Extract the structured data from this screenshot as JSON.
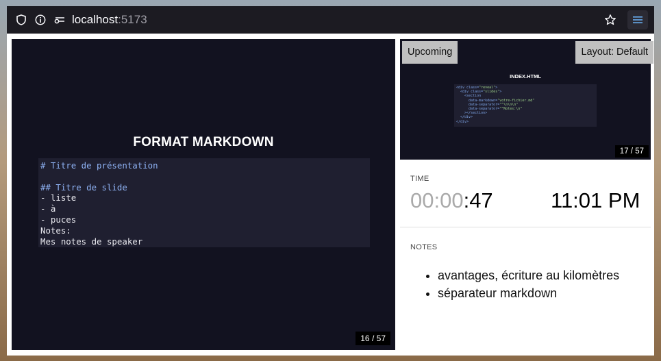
{
  "browser": {
    "url_host": "localhost",
    "url_port": ":5173"
  },
  "current_slide": {
    "title": "FORMAT MARKDOWN",
    "code_lines": [
      {
        "text": "# Titre de présentation",
        "highlight": true
      },
      {
        "text": "",
        "highlight": false
      },
      {
        "text": "## Titre de slide",
        "highlight": true
      },
      {
        "text": "- liste",
        "highlight": false
      },
      {
        "text": "- à",
        "highlight": false
      },
      {
        "text": "- puces",
        "highlight": false
      },
      {
        "text": "Notes:",
        "highlight": false
      },
      {
        "text": "Mes notes de speaker",
        "highlight": false
      }
    ],
    "counter": {
      "current": "16",
      "separator": "/",
      "total": "57"
    }
  },
  "upcoming": {
    "label": "Upcoming",
    "layout_button": "Layout: Default",
    "title": "INDEX.HTML",
    "code_lines": [
      "<div class=\"reveal\">",
      "  <div class=\"slides\">",
      "    <section",
      "      data-markdown=\"votre-fichier.md\"",
      "      data-separator=\"^\\n\\n\\n\"",
      "      data-separator=\"^Notes:\\n\"",
      "    ></section>",
      "  </div>",
      "</div>"
    ],
    "counter": {
      "current": "17",
      "separator": "/",
      "total": "57"
    }
  },
  "time": {
    "label": "TIME",
    "timer_dim": "00:00",
    "timer_active": ":47",
    "clock": "11:01 PM"
  },
  "notes": {
    "label": "NOTES",
    "items": [
      "avantages, écriture au kilomètres",
      "séparateur markdown"
    ]
  },
  "colors": {
    "slide_bg": "#121220",
    "code_bg": "#1f1f30",
    "code_highlight": "#8fb3f5",
    "toolbar_bg": "#1c1b22"
  }
}
